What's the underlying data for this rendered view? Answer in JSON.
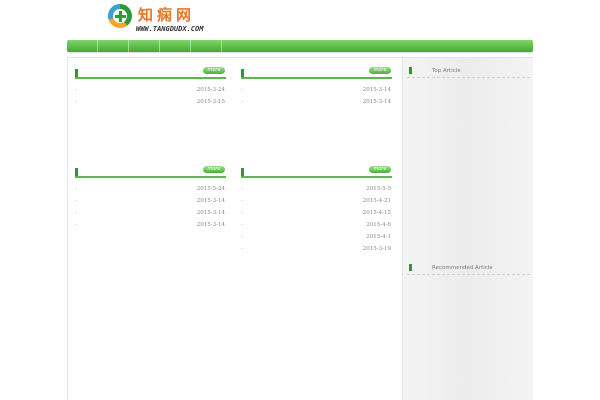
{
  "logo": {
    "title": "知痫网",
    "url": "WWW.TANGDUDX.COM",
    "icon": "logo-medical-cross-icon"
  },
  "nav": {
    "items": [
      "",
      "",
      "",
      "",
      ""
    ]
  },
  "categories": [
    {
      "name": "",
      "more_label": "more",
      "rows": [
        {
          "title": "",
          "date": "2015-3-24"
        },
        {
          "title": "",
          "date": "2015-3-15"
        }
      ]
    },
    {
      "name": "",
      "more_label": "more",
      "rows": [
        {
          "title": "",
          "date": "2015-3-14"
        },
        {
          "title": "",
          "date": "2015-3-14"
        }
      ]
    },
    {
      "name": "",
      "more_label": "more",
      "rows": [
        {
          "title": "",
          "date": "2015-5-24"
        },
        {
          "title": "",
          "date": "2015-3-14"
        },
        {
          "title": "",
          "date": "2015-3-14"
        },
        {
          "title": "",
          "date": "2015-3-14"
        }
      ]
    },
    {
      "name": "",
      "more_label": "more",
      "rows": [
        {
          "title": "",
          "date": "2015-5-5"
        },
        {
          "title": "",
          "date": "2015-4-21"
        },
        {
          "title": "",
          "date": "2015-4-15"
        },
        {
          "title": "",
          "date": "2015-4-6"
        },
        {
          "title": "",
          "date": "2015-4-1"
        },
        {
          "title": "",
          "date": "2015-3-19"
        }
      ]
    }
  ],
  "sidebar": {
    "top_article": "Top Article",
    "recommended_article": "Recommended Article"
  },
  "colors": {
    "accent_green": "#5bb84c",
    "marker_green": "#2a9a2f",
    "logo_orange": "#e8772e"
  }
}
